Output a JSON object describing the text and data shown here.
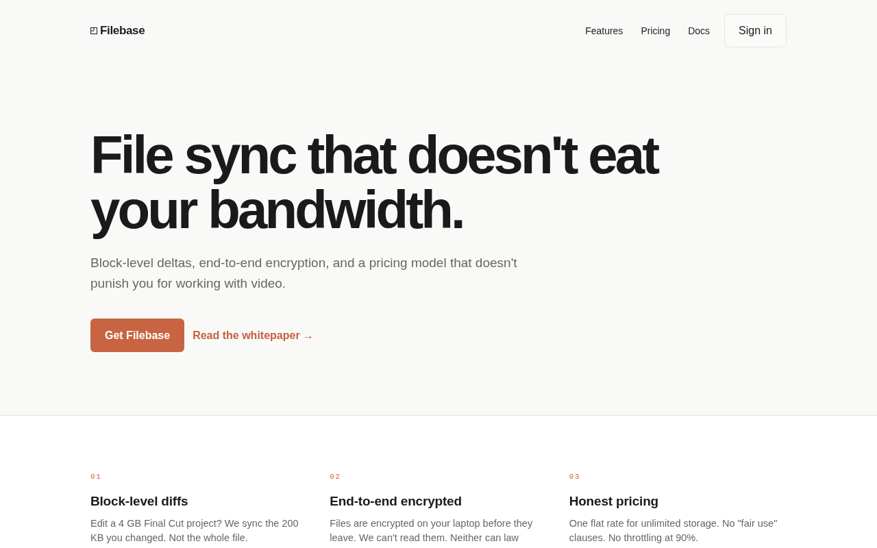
{
  "header": {
    "logo": "Filebase",
    "nav": [
      "Features",
      "Pricing",
      "Docs"
    ],
    "sign_in": "Sign in"
  },
  "hero": {
    "headline": "File sync that doesn't eat your bandwidth.",
    "subtitle": "Block-level deltas, end-to-end encryption, and a pricing model that doesn't punish you for working with video.",
    "primary_button": "Get Filebase",
    "link": "Read the whitepaper →"
  },
  "features": [
    {
      "number": "01",
      "title": "Block-level diffs",
      "description": "Edit a 4 GB Final Cut project? We sync the 200 KB you changed. Not the whole file."
    },
    {
      "number": "02",
      "title": "End-to-end encrypted",
      "description": "Files are encrypted on your laptop before they leave. We can't read them. Neither can law"
    },
    {
      "number": "03",
      "title": "Honest pricing",
      "description": "One flat rate for unlimited storage. No \"fair use\" clauses. No throttling at 90%."
    }
  ]
}
